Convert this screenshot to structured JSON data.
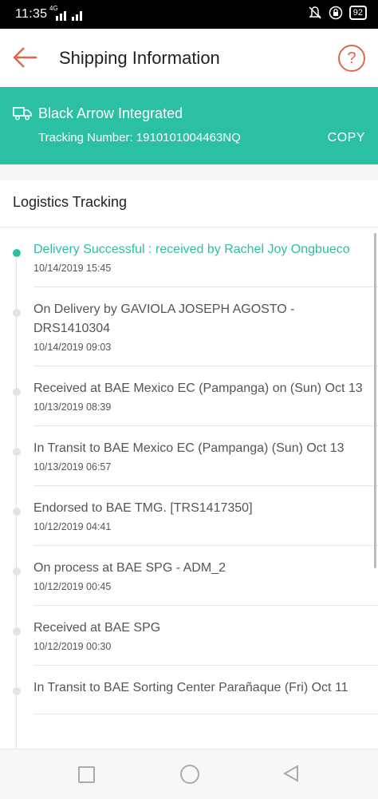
{
  "status_bar": {
    "time": "11:35",
    "network": "4G",
    "battery": "92"
  },
  "header": {
    "title": "Shipping Information",
    "help_symbol": "?"
  },
  "carrier": {
    "name": "Black Arrow Integrated",
    "tracking_label": "Tracking Number: 1910101004463NQ",
    "copy_label": "COPY",
    "icon": "truck-icon",
    "accent": "#2bbfa4"
  },
  "logistics": {
    "title": "Logistics Tracking",
    "events": [
      {
        "desc": "Delivery Successful : received by Rachel Joy Ongbueco",
        "time": "10/14/2019 15:45"
      },
      {
        "desc": "On Delivery by GAVIOLA JOSEPH AGOSTO - DRS1410304",
        "time": "10/14/2019 09:03"
      },
      {
        "desc": "Received at BAE Mexico EC (Pampanga) on (Sun) Oct 13",
        "time": "10/13/2019 08:39"
      },
      {
        "desc": "In Transit to BAE Mexico EC (Pampanga) (Sun) Oct 13",
        "time": "10/13/2019 06:57"
      },
      {
        "desc": "Endorsed to BAE TMG. [TRS1417350]",
        "time": "10/12/2019 04:41"
      },
      {
        "desc": "On process at BAE SPG - ADM_2",
        "time": "10/12/2019 00:45"
      },
      {
        "desc": "Received at BAE SPG",
        "time": "10/12/2019 00:30"
      },
      {
        "desc": "In Transit to BAE Sorting Center Parañaque (Fri) Oct 11",
        "time": ""
      }
    ]
  }
}
